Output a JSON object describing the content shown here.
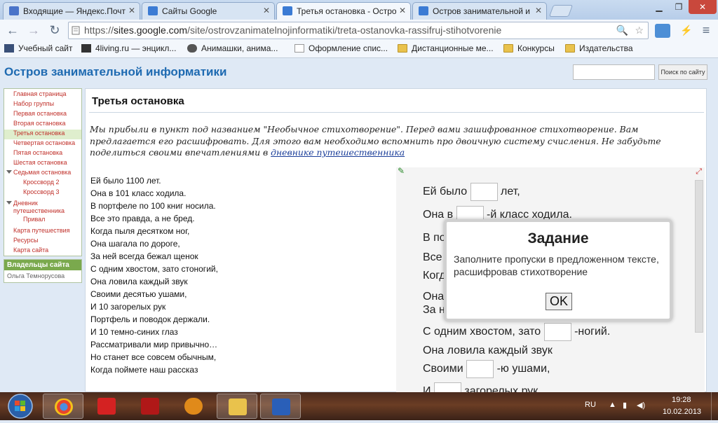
{
  "tabs": [
    {
      "title": "Входящие — Яндекс.Почт",
      "icon": "mail-icon"
    },
    {
      "title": "Сайты Google",
      "icon": "google-sites-icon"
    },
    {
      "title": "Третья остановка - Остро",
      "icon": "google-sites-icon"
    },
    {
      "title": "Остров занимательной и",
      "icon": "google-sites-icon"
    }
  ],
  "browser": {
    "url_prefix": "https://",
    "url_domain": "sites.google.com",
    "url_path": "/site/ostrovzanimatelnojinformatiki/treta-ostanovka-rassifruj-stihotvorenie"
  },
  "bookmarks": [
    {
      "label": "Учебный сайт",
      "icon": "folder-icon"
    },
    {
      "label": "4living.ru — энцикл...",
      "icon": "site-icon"
    },
    {
      "label": "Анимашки, анима...",
      "icon": "site-icon"
    },
    {
      "label": "Оформление спис...",
      "icon": "page-icon"
    },
    {
      "label": "Дистанционные ме...",
      "icon": "folder-icon"
    },
    {
      "label": "Конкурсы",
      "icon": "folder-icon"
    },
    {
      "label": "Издательства",
      "icon": "folder-icon"
    }
  ],
  "site": {
    "title": "Остров занимательной информатики",
    "search_button": "Поиск по сайту"
  },
  "nav": [
    {
      "label": "Главная страница",
      "level": 0
    },
    {
      "label": "Набор группы",
      "level": 0
    },
    {
      "label": "Первая остановка",
      "level": 0
    },
    {
      "label": "Вторая остановка",
      "level": 0
    },
    {
      "label": "Третья остановка",
      "level": 0,
      "selected": true
    },
    {
      "label": "Четвертая остановка",
      "level": 0
    },
    {
      "label": "Пятая остановка",
      "level": 0
    },
    {
      "label": "Шестая остановка",
      "level": 0
    },
    {
      "label": "Седьмая остановка",
      "level": 0,
      "expanded": true
    },
    {
      "label": "Кроссворд 2",
      "level": 1
    },
    {
      "label": "Кроссворд 3",
      "level": 1
    },
    {
      "label": "Дневник",
      "level": 0,
      "expanded": true
    },
    {
      "label": "путешественника",
      "level": 0
    },
    {
      "label": "Привал",
      "level": 1
    },
    {
      "label": "Карта путешествия",
      "level": 0
    },
    {
      "label": "Ресурсы",
      "level": 0
    },
    {
      "label": "Карта сайта",
      "level": 0
    }
  ],
  "owners": {
    "header": "Владельцы сайта",
    "name": "Ольга Темнорусова"
  },
  "page": {
    "title": "Третья остановка",
    "intro": "Мы прибыли в пункт под названием \"Необычное стихотворение\". Перед вами зашифрованное стихотворение. Вам предлагается его расшифровать. Для этого вам необходимо вспомнить про двоичную систему счисления. Не забудьте поделиться своими впечатлениями в ",
    "intro_link": "дневнике путешественника"
  },
  "poem": [
    "Ей было 1100 лет.",
    "Она в 101 класс ходила.",
    "В портфеле по 100 книг носила.",
    "Все это правда, а не бред.",
    "Когда пыля десятком ног,",
    "Она шагала по дороге,",
    "За ней всегда бежал щенок",
    "С одним хвостом, зато стоногий,",
    "Она ловила каждый звук",
    "Своими десятью ушами,",
    "И 10 загорелых рук",
    "Портфель и поводок держали.",
    "И 10 темно-синих глаз",
    "Рассматривали мир привычно…",
    "Но станет все совсем обычным,",
    "Когда поймете наш рассказ"
  ],
  "gadget": {
    "l1a": "Ей было",
    "l1b": "лет,",
    "l2a": "Она в",
    "l2b": "-й класс ходила.",
    "l3": "В по",
    "l4": "Все",
    "l5": "Когд",
    "l6": "Она",
    "l7": "За н",
    "l8a": "С одним хвостом, зато",
    "l8b": "-ногий.",
    "l9": "Она ловила каждый звук",
    "l10a": "Своими",
    "l10b": "-ю ушами,",
    "l11a": "И",
    "l11b": "загорелых рук"
  },
  "modal": {
    "title": "Задание",
    "text": "Заполните пропуски в предложенном тексте, расшифровав стихотворение",
    "ok": "OK"
  },
  "tray": {
    "lang": "RU",
    "time": "19:28",
    "date": "10.02.2013"
  }
}
